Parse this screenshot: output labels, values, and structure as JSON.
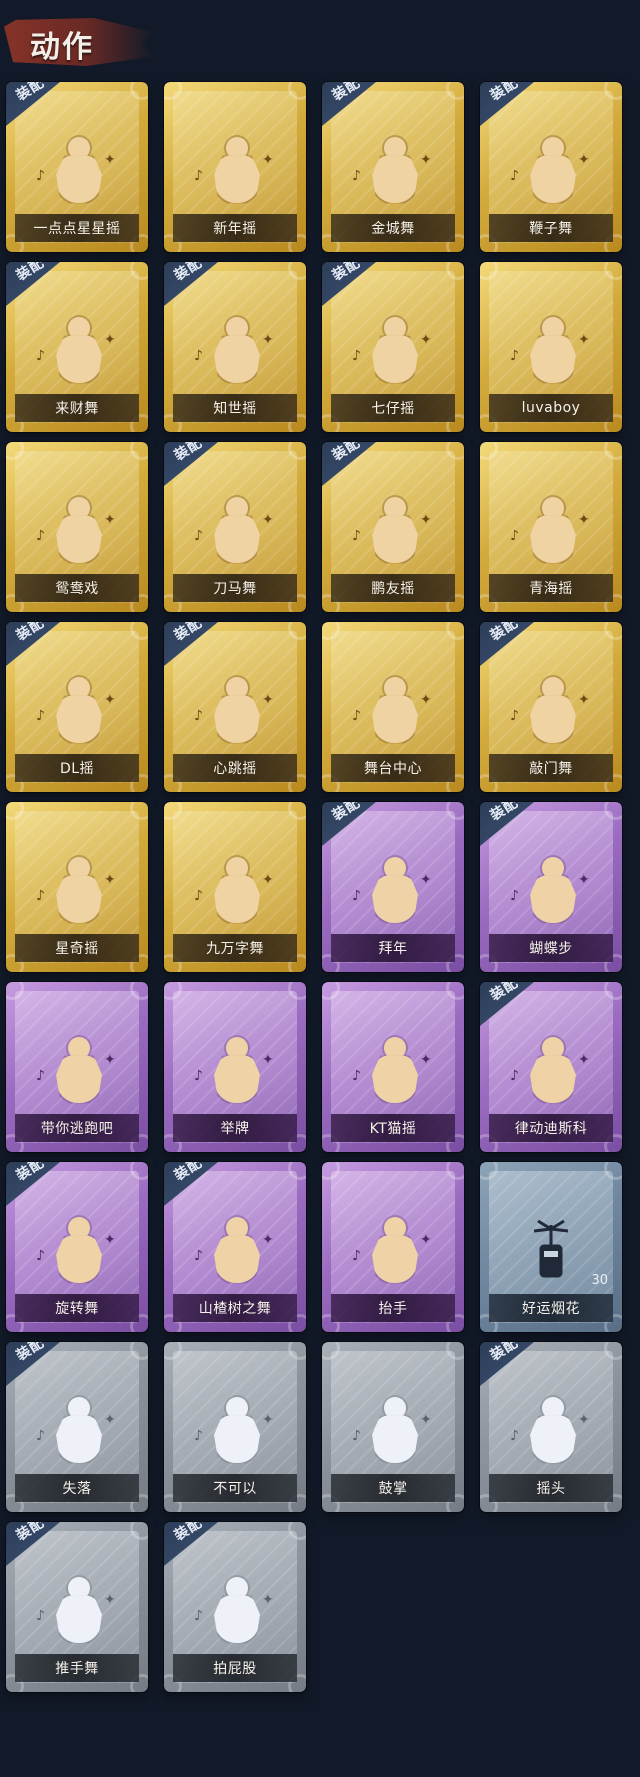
{
  "header": {
    "title": "动作"
  },
  "equip_label": "装配",
  "cards": [
    {
      "label": "一点点星星摇",
      "tier": "gold",
      "equipped": true,
      "icon": "dance-figure-icon"
    },
    {
      "label": "新年摇",
      "tier": "gold",
      "equipped": false,
      "icon": "dance-figure-icon"
    },
    {
      "label": "金城舞",
      "tier": "gold",
      "equipped": true,
      "icon": "dance-figure-icon"
    },
    {
      "label": "鞭子舞",
      "tier": "gold",
      "equipped": true,
      "icon": "dance-figure-icon"
    },
    {
      "label": "来财舞",
      "tier": "gold",
      "equipped": true,
      "icon": "dance-figure-icon"
    },
    {
      "label": "知世摇",
      "tier": "gold",
      "equipped": true,
      "icon": "dance-figure-icon"
    },
    {
      "label": "七仔摇",
      "tier": "gold",
      "equipped": true,
      "icon": "dance-figure-icon"
    },
    {
      "label": "luvaboy",
      "tier": "gold",
      "equipped": false,
      "icon": "dance-figure-icon"
    },
    {
      "label": "鸳鸯戏",
      "tier": "gold",
      "equipped": false,
      "icon": "dance-figure-icon"
    },
    {
      "label": "刀马舞",
      "tier": "gold",
      "equipped": true,
      "icon": "dance-figure-icon"
    },
    {
      "label": "鹏友摇",
      "tier": "gold",
      "equipped": true,
      "icon": "dance-figure-icon"
    },
    {
      "label": "青海摇",
      "tier": "gold",
      "equipped": false,
      "icon": "dance-figure-icon"
    },
    {
      "label": "DL摇",
      "tier": "gold",
      "equipped": true,
      "icon": "dance-figure-icon"
    },
    {
      "label": "心跳摇",
      "tier": "gold",
      "equipped": true,
      "icon": "dance-figure-icon"
    },
    {
      "label": "舞台中心",
      "tier": "gold",
      "equipped": false,
      "icon": "dance-figure-icon"
    },
    {
      "label": "敲门舞",
      "tier": "gold",
      "equipped": true,
      "icon": "dance-figure-icon"
    },
    {
      "label": "星奇摇",
      "tier": "gold",
      "equipped": false,
      "icon": "dance-figure-icon"
    },
    {
      "label": "九万字舞",
      "tier": "gold",
      "equipped": false,
      "icon": "dance-figure-icon"
    },
    {
      "label": "拜年",
      "tier": "purple",
      "equipped": true,
      "icon": "bow-figure-icon"
    },
    {
      "label": "蝴蝶步",
      "tier": "purple",
      "equipped": true,
      "icon": "point-figure-icon"
    },
    {
      "label": "带你逃跑吧",
      "tier": "purple",
      "equipped": false,
      "icon": "dance-figure-icon"
    },
    {
      "label": "举牌",
      "tier": "purple",
      "equipped": false,
      "icon": "sign-figure-icon"
    },
    {
      "label": "KT猫摇",
      "tier": "purple",
      "equipped": false,
      "icon": "dance-figure-icon"
    },
    {
      "label": "律动迪斯科",
      "tier": "purple",
      "equipped": true,
      "icon": "disco-figure-icon"
    },
    {
      "label": "旋转舞",
      "tier": "purple",
      "equipped": true,
      "icon": "spin-figure-icon"
    },
    {
      "label": "山楂树之舞",
      "tier": "purple",
      "equipped": true,
      "icon": "dance-figure-icon"
    },
    {
      "label": "抬手",
      "tier": "purple",
      "equipped": false,
      "icon": "raise-hand-icon"
    },
    {
      "label": "好运烟花",
      "tier": "blue",
      "equipped": false,
      "icon": "firework-icon",
      "count": "30"
    },
    {
      "label": "失落",
      "tier": "silver",
      "equipped": true,
      "icon": "crawl-figure-icon"
    },
    {
      "label": "不可以",
      "tier": "silver",
      "equipped": false,
      "icon": "finger-no-icon"
    },
    {
      "label": "鼓掌",
      "tier": "silver",
      "equipped": false,
      "icon": "clap-icon"
    },
    {
      "label": "摇头",
      "tier": "silver",
      "equipped": true,
      "icon": "headshake-figure-icon"
    },
    {
      "label": "推手舞",
      "tier": "silver",
      "equipped": true,
      "icon": "push-figure-icon"
    },
    {
      "label": "拍屁股",
      "tier": "silver",
      "equipped": true,
      "icon": "pat-figure-icon"
    }
  ]
}
